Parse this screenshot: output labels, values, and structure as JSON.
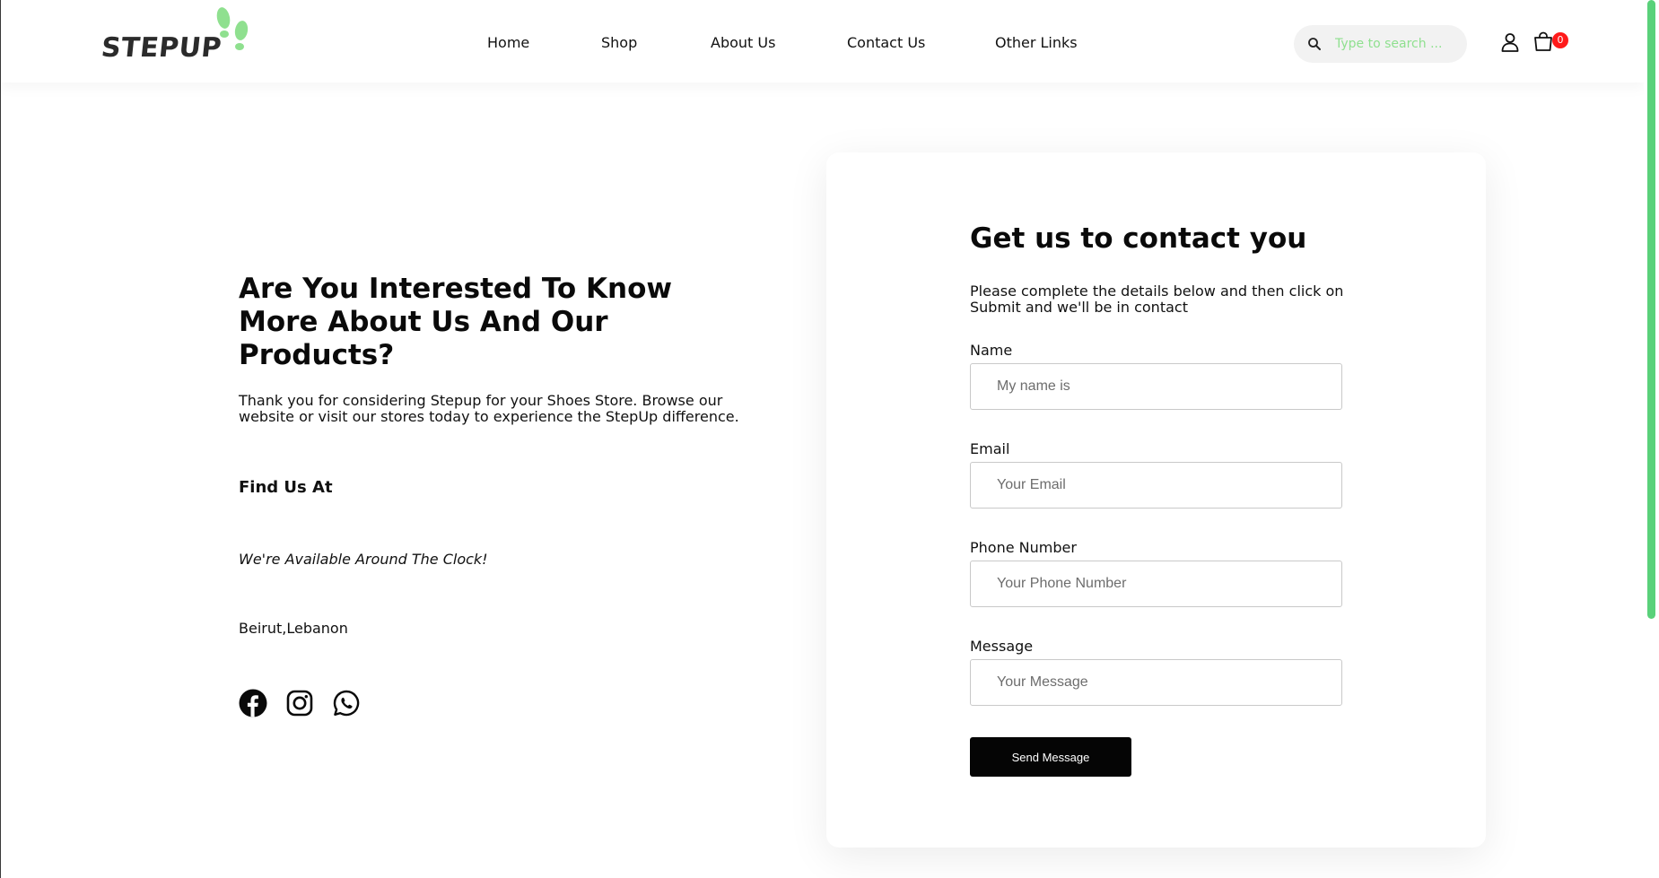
{
  "brand": {
    "name": "STEPUP",
    "accent": "#8fe08f"
  },
  "nav": {
    "items": [
      {
        "label": "Home"
      },
      {
        "label": "Shop"
      },
      {
        "label": "About Us"
      },
      {
        "label": "Contact Us"
      },
      {
        "label": "Other Links"
      }
    ]
  },
  "search": {
    "placeholder": "Type to search ..."
  },
  "header_icons": {
    "user": "user-icon",
    "cart": "cart-icon",
    "cart_count": "0"
  },
  "intro": {
    "heading": "Are You Interested To Know More About Us And Our Products?",
    "paragraph": "Thank you for considering Stepup for your Shoes Store. Browse our website or visit our stores today to experience the StepUp difference.",
    "find_title": "Find Us At",
    "availability": "We're Available Around The Clock!",
    "location": "Beirut,Lebanon",
    "social": [
      "facebook-icon",
      "instagram-icon",
      "whatsapp-icon"
    ]
  },
  "form": {
    "title": "Get us to contact you",
    "subtitle": "Please complete the details below and then click on Submit and we'll be in contact",
    "fields": [
      {
        "label": "Name",
        "placeholder": "My name is",
        "value": ""
      },
      {
        "label": "Email",
        "placeholder": "Your Email",
        "value": ""
      },
      {
        "label": "Phone Number",
        "placeholder": "Your Phone Number",
        "value": ""
      },
      {
        "label": "Message",
        "placeholder": "Your Message",
        "value": ""
      }
    ],
    "submit_label": "Send Message"
  },
  "colors": {
    "badge": "#ff1a1a",
    "button": "#050505",
    "scroll_thumb": "#5ad17a"
  }
}
